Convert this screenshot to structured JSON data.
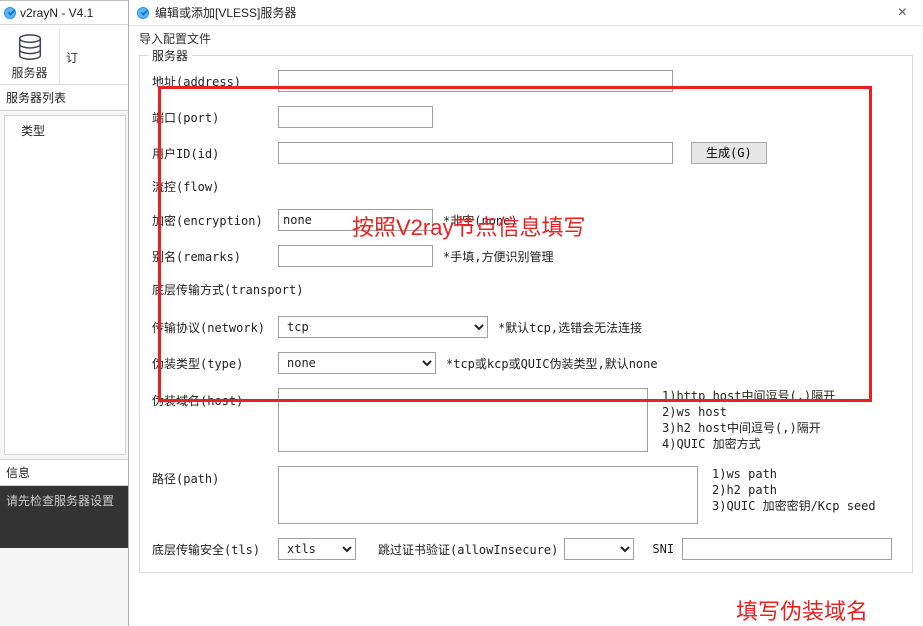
{
  "bg": {
    "title": "v2rayN - V4.1",
    "toolbar": {
      "servers": "服务器",
      "sub": "订"
    },
    "sidebar_label": "服务器列表",
    "tree_col": "类型",
    "info_label": "信息",
    "status": "请先检查服务器设置"
  },
  "dialog": {
    "title": "编辑或添加[VLESS]服务器",
    "close_x": "×",
    "menu_import": "导入配置文件",
    "group_label": "服务器",
    "labels": {
      "address": "地址(address)",
      "port": "端口(port)",
      "id": "用户ID(id)",
      "flow": "流控(flow)",
      "encryption": "加密(encryption)",
      "remarks": "别名(remarks)",
      "transport_title": "底层传输方式(transport)",
      "network": "传输协议(network)",
      "type": "伪装类型(type)",
      "host": "伪装域名(host)",
      "path": "路径(path)",
      "tls": "底层传输安全(tls)",
      "allow_insecure": "跳过证书验证(allowInsecure)",
      "sni": "SNI"
    },
    "values": {
      "address": "",
      "port": "",
      "id": "",
      "encryption": "none",
      "remarks": "",
      "network": "tcp",
      "type": "none",
      "host": "",
      "path": "",
      "tls": "xtls",
      "allow_insecure": "",
      "sni": ""
    },
    "buttons": {
      "generate": "生成(G)"
    },
    "hints": {
      "encryption": "*非空(none)",
      "remarks": "*手填,方便识别管理",
      "network": "*默认tcp,选错会无法连接",
      "type": "*tcp或kcp或QUIC伪装类型,默认none",
      "host1": "1)http host中间逗号(,)隔开",
      "host2": "2)ws host",
      "host3": "3)h2 host中间逗号(,)隔开",
      "host4": "4)QUIC 加密方式",
      "path1": "1)ws path",
      "path2": "2)h2 path",
      "path3": "3)QUIC 加密密钥/Kcp seed"
    }
  },
  "annotations": {
    "top": "按照V2ray节点信息填写",
    "bottom": "填写伪装域名"
  }
}
